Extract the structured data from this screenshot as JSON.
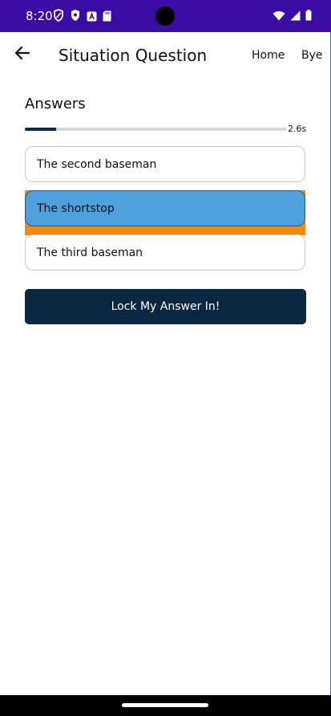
{
  "status_bar": {
    "time": "8:20",
    "left_icons": [
      "vpn-shield-icon",
      "shield-icon",
      "a-box-icon",
      "sd-card-icon"
    ],
    "right_icons": [
      "wifi-icon",
      "signal-icon",
      "battery-icon"
    ]
  },
  "header": {
    "title": "Situation Question",
    "nav_home": "Home",
    "nav_bye": "Bye"
  },
  "main": {
    "heading": "Answers",
    "timer_label": "2.6s",
    "timer_progress_fraction": 0.12,
    "answers": [
      {
        "label": "The second baseman",
        "selected": false
      },
      {
        "label": "The shortstop",
        "selected": true
      },
      {
        "label": "The third baseman",
        "selected": false
      }
    ],
    "lock_button_label": "Lock My Answer In!"
  },
  "colors": {
    "status_bar": "#3a0ca3",
    "selected_answer": "#4ea0dd",
    "selection_highlight": "#f28a12",
    "primary_button": "#0a2742",
    "progress_fill": "#0d2a45"
  }
}
